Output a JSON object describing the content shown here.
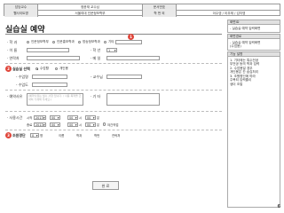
{
  "header": {
    "row1": [
      {
        "label": "담당교수",
        "value": "정윤재 교수님"
      },
      {
        "label": "문서번호",
        "value": ""
      }
    ],
    "row2": [
      {
        "label": "웹사이트명",
        "value": "서울여대 인문정보학부"
      },
      {
        "label": "학 번 외",
        "value": "이수영 / 이우재 / 김지영"
      }
    ]
  },
  "form": {
    "title": "실습실 예약",
    "dept": {
      "label": "· 학 과",
      "options": [
        "인문정보학부",
        "인문홍보학과",
        "방송정보학과",
        "기타"
      ]
    },
    "name_label": "· 이 름",
    "grade_label": "· 학 년",
    "grade_value": "1",
    "phone_label": "· 연락처",
    "email_label": "· 메 일",
    "room": {
      "label": "실습실 선택",
      "options": [
        "수업활",
        "개인용"
      ],
      "course_label": "- 수업명",
      "professor_label": "- 교수님",
      "credit_label": "- 수업도"
    },
    "purpose": {
      "label": "· 예약사유",
      "placeholder": "(예약사유는 필수 사항 입니다. / 사용 목적을 간략히 기재해 주세요.)",
      "other_label": "· 기 타"
    },
    "time": {
      "label": "· 사용시간",
      "start_label": "시작",
      "end_label": "종료",
      "year": "2013",
      "mm": "00",
      "unit": "시",
      "min_unit": "분",
      "overnight": "야간작업"
    },
    "cohort": {
      "label": "조원명단",
      "value": "0",
      "unit": "명",
      "cols": [
        "이름",
        "학과",
        "학번",
        "연락처"
      ]
    },
    "submit": "완 료"
  },
  "sidebar": {
    "sections": [
      {
        "title": "화면ID",
        "body": [
          "- 실습실 예약 입력화면"
        ]
      },
      {
        "title": "화면경로",
        "body": [
          "- 실습실 예약 입력화면",
          "  (수업용)"
        ]
      },
      {
        "title": "기능 설명",
        "body": [
          "1.  기타에는 특수전공",
          "    부전공 등의 학과 입력",
          "2.  수업용일 경우",
          "    개인용은 칸 숨김처리",
          "3.  조원명단에 따라",
          "    주복되 입력줄이",
          "    생이 조컬"
        ]
      }
    ]
  },
  "page_number": "6",
  "colors": {
    "badge": "#e0453a"
  }
}
